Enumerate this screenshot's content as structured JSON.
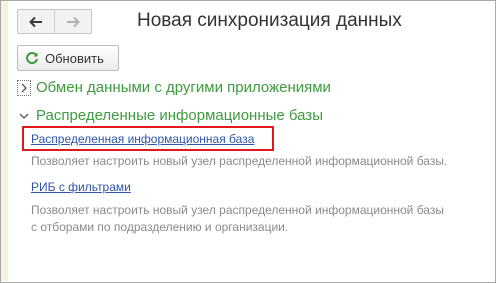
{
  "window": {
    "title": "Новая синхронизация данных"
  },
  "nav": {
    "back_icon": "arrow-left-icon",
    "forward_icon": "arrow-right-icon"
  },
  "toolbar": {
    "refresh_label": "Обновить",
    "refresh_icon": "refresh-icon"
  },
  "groups": [
    {
      "label": "Обмен данными с другими приложениями",
      "state": "collapsed"
    },
    {
      "label": "Распределенные информационные базы",
      "state": "expanded",
      "items": [
        {
          "link": "Распределенная информационная база",
          "description": "Позволяет настроить новый узел распределенной информационной базы."
        },
        {
          "link": "РИБ с фильтрами",
          "description_lines": [
            "Позволяет настроить новый узел распределенной информационной базы",
            "с отборами по подразделению и организации."
          ]
        }
      ]
    }
  ],
  "colors": {
    "group_header": "#3e9b3e",
    "link": "#2f55a6",
    "description": "#8a8a8a",
    "highlight": "#e0191e",
    "refresh_icon": "#3a9a3a"
  }
}
